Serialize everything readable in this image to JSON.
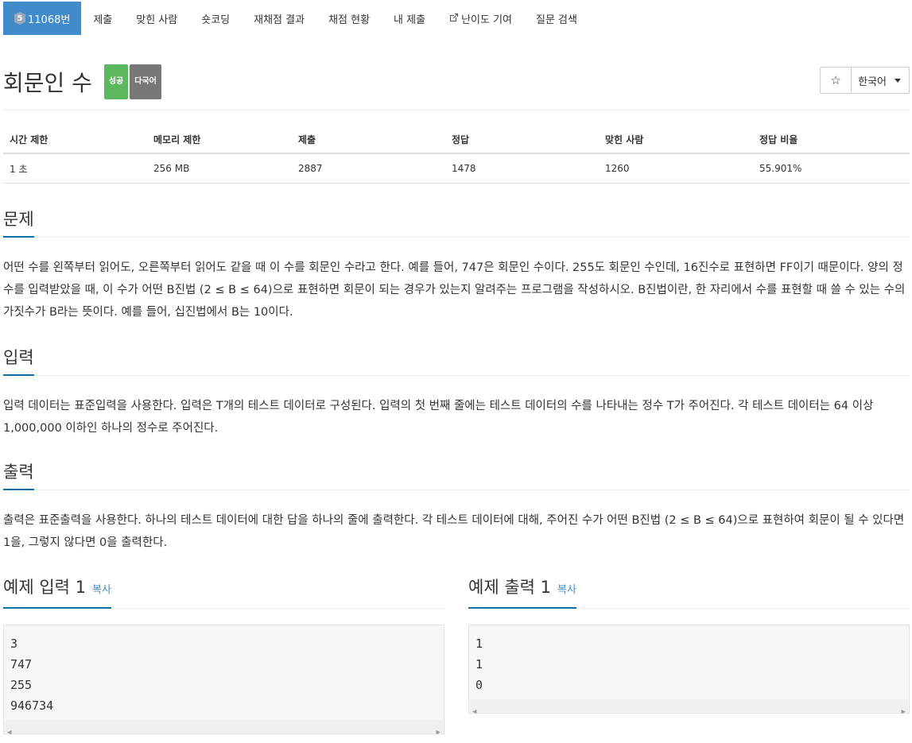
{
  "nav": {
    "tier": "5",
    "problem_number": "11068번",
    "items": [
      "제출",
      "맞힌 사람",
      "숏코딩",
      "재채점 결과",
      "채점 현황",
      "내 제출",
      "난이도 기여",
      "질문 검색"
    ]
  },
  "problem": {
    "title": "회문인 수",
    "badge_success": "성공",
    "badge_multi": "다국어",
    "star": "☆",
    "language": "한국어"
  },
  "info": {
    "headers": [
      "시간 제한",
      "메모리 제한",
      "제출",
      "정답",
      "맞힌 사람",
      "정답 비율"
    ],
    "values": [
      "1 초",
      "256 MB",
      "2887",
      "1478",
      "1260",
      "55.901%"
    ]
  },
  "sections": {
    "problem_heading": "문제",
    "problem_text": "어떤 수를 왼쪽부터 읽어도, 오른쪽부터 읽어도 같을 때 이 수를 회문인 수라고 한다. 예를 들어, 747은 회문인 수이다. 255도 회문인 수인데, 16진수로 표현하면 FF이기 때문이다. 양의 정수를 입력받았을 때, 이 수가 어떤 B진법 (2 ≤ B ≤ 64)으로 표현하면 회문이 되는 경우가 있는지 알려주는 프로그램을 작성하시오. B진법이란, 한 자리에서 수를 표현할 때 쓸 수 있는 수의 가짓수가 B라는 뜻이다. 예를 들어, 십진법에서 B는 10이다.",
    "input_heading": "입력",
    "input_text": "입력 데이터는 표준입력을 사용한다. 입력은 T개의 테스트 데이터로 구성된다. 입력의 첫 번째 줄에는 테스트 데이터의 수를 나타내는 정수 T가 주어진다. 각 테스트 데이터는 64 이상 1,000,000 이하인 하나의 정수로 주어진다.",
    "output_heading": "출력",
    "output_text": "출력은 표준출력을 사용한다. 하나의 테스트 데이터에 대한 답을 하나의 줄에 출력한다. 각 테스트 데이터에 대해, 주어진 수가 어떤 B진법 (2 ≤ B ≤ 64)으로 표현하여 회문이 될 수 있다면 1을, 그렇지 않다면 0을 출력한다."
  },
  "samples": {
    "input_heading": "예제 입력 1",
    "output_heading": "예제 출력 1",
    "copy_label": "복사",
    "input_lines": [
      "3",
      "747",
      "255",
      "946734"
    ],
    "output_lines": [
      "1",
      "1",
      "0"
    ]
  },
  "colors": {
    "active_tab": "#428bca",
    "success": "#5cb85c",
    "default_label": "#777777",
    "heading_underline": "#0b6fa8"
  }
}
